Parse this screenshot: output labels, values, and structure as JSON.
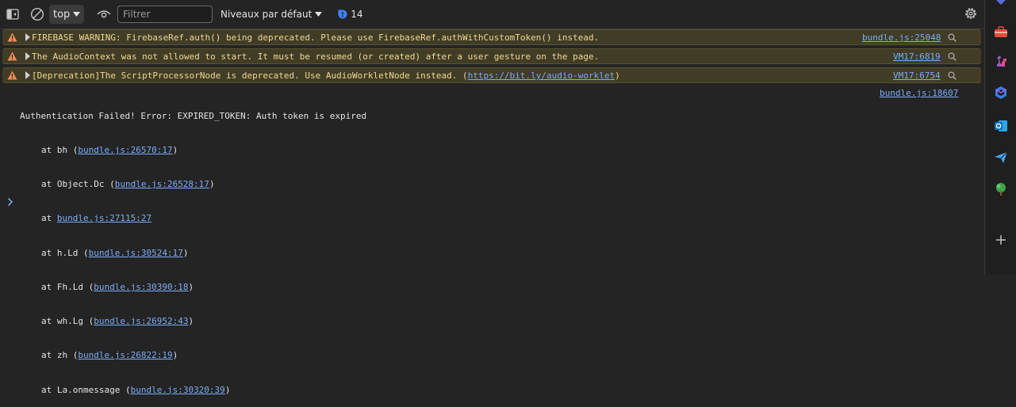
{
  "toolbar": {
    "context_value": "top",
    "filter_placeholder": "Filtrer",
    "levels_label": "Niveaux par défaut",
    "issues_count": "14"
  },
  "warnings": [
    {
      "text": "FIREBASE WARNING: FirebaseRef.auth() being deprecated. Please use FirebaseRef.authWithCustomToken() instead.",
      "source": "bundle.js:25048"
    },
    {
      "text": "The AudioContext was not allowed to start. It must be resumed (or created) after a user gesture on the page.",
      "source": "VM17:6819"
    },
    {
      "text_before": "[Deprecation]The ScriptProcessorNode is deprecated. Use AudioWorkletNode instead. (",
      "link": "https://bit.ly/audio-worklet",
      "text_after": ")",
      "source": "VM17:6754"
    }
  ],
  "error": {
    "message": "Authentication Failed! Error: EXPIRED_TOKEN: Auth token is expired",
    "source": "bundle.js:18607",
    "frames": [
      {
        "prefix": "at bh (",
        "link": "bundle.js:26570:17",
        "suffix": ")"
      },
      {
        "prefix": "at Object.Dc (",
        "link": "bundle.js:26528:17",
        "suffix": ")"
      },
      {
        "prefix": "at ",
        "link": "bundle.js:27115:27",
        "suffix": ""
      },
      {
        "prefix": "at h.Ld (",
        "link": "bundle.js:30524:17",
        "suffix": ")"
      },
      {
        "prefix": "at Fh.Ld (",
        "link": "bundle.js:30390:18",
        "suffix": ")"
      },
      {
        "prefix": "at wh.Lg (",
        "link": "bundle.js:26952:43",
        "suffix": ")"
      },
      {
        "prefix": "at zh (",
        "link": "bundle.js:26822:19",
        "suffix": ")"
      },
      {
        "prefix": "at La.onmessage (",
        "link": "bundle.js:30320:39",
        "suffix": ")"
      }
    ]
  },
  "sidebar": {
    "icons": [
      "tools-icon",
      "chess-icon",
      "copilot-icon",
      "outlook-icon",
      "send-icon",
      "tree-icon",
      "add-icon"
    ]
  },
  "colors": {
    "warning_bg": "#413c26",
    "warning_text": "#f0d996",
    "link": "#7cacf8",
    "issues_accent": "#3b82f6",
    "warning_icon": "#f28b54"
  }
}
